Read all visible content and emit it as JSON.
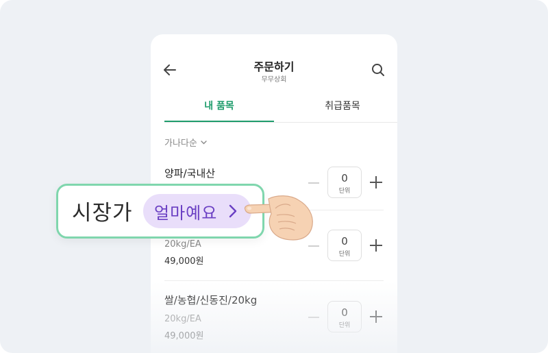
{
  "header": {
    "title": "주문하기",
    "subtitle": "무무상회"
  },
  "tabs": [
    {
      "label": "내 품목",
      "active": true
    },
    {
      "label": "취급품목",
      "active": false
    }
  ],
  "sort": {
    "label": "가나다순"
  },
  "items": [
    {
      "name": "양파/국내산",
      "spec": "",
      "price": "",
      "qty": "0",
      "unit": "단위"
    },
    {
      "name": "",
      "spec": "20kg/EA",
      "price": "49,000원",
      "qty": "0",
      "unit": "단위"
    },
    {
      "name": "쌀/농협/신동진/20kg",
      "spec": "20kg/EA",
      "price": "49,000원",
      "qty": "0",
      "unit": "단위"
    }
  ],
  "callout": {
    "label": "시장가",
    "button_label": "얼마예요"
  },
  "colors": {
    "accent": "#1e9c6c",
    "callout_border": "#7fd6ad",
    "pill_bg": "#e9defa",
    "pill_text": "#6a3fc3"
  },
  "icons": {
    "back": "arrow-left-icon",
    "search": "search-icon",
    "sort": "chevron-down-icon",
    "pill": "chevron-right-icon",
    "pointer": "pointing-hand-icon"
  }
}
